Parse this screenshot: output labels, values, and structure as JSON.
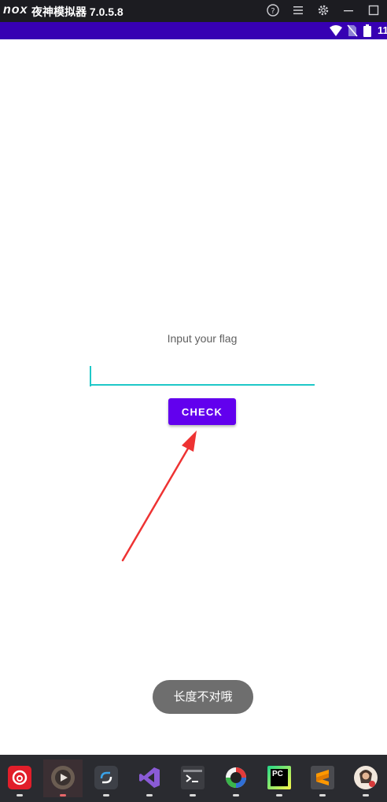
{
  "window": {
    "logo_text": "nox",
    "title": "夜神模拟器 7.0.5.8",
    "toolbar_icons": [
      "help-icon",
      "menu-icon",
      "gear-icon",
      "minimize-icon",
      "maximize-icon"
    ]
  },
  "status_bar": {
    "time": "11",
    "icons": [
      "wifi-icon",
      "no-sim-icon",
      "battery-icon"
    ],
    "color": "#3700b3"
  },
  "app": {
    "prompt_label": "Input your flag",
    "input_value": "",
    "check_label": "CHECK",
    "accent_color": "#6200ee",
    "input_line_color": "#1fc8c8"
  },
  "toast": {
    "message": "长度不对哦"
  },
  "taskbar": {
    "items": [
      {
        "icon": "netease-music-icon"
      },
      {
        "icon": "media-player-icon",
        "active": true
      },
      {
        "icon": "sync-app-icon"
      },
      {
        "icon": "visual-studio-icon"
      },
      {
        "icon": "terminal-icon"
      },
      {
        "icon": "jadx-icon"
      },
      {
        "icon": "pycharm-icon",
        "text": "PC"
      },
      {
        "icon": "sublime-text-icon"
      },
      {
        "icon": "avatar-app-icon"
      }
    ]
  }
}
